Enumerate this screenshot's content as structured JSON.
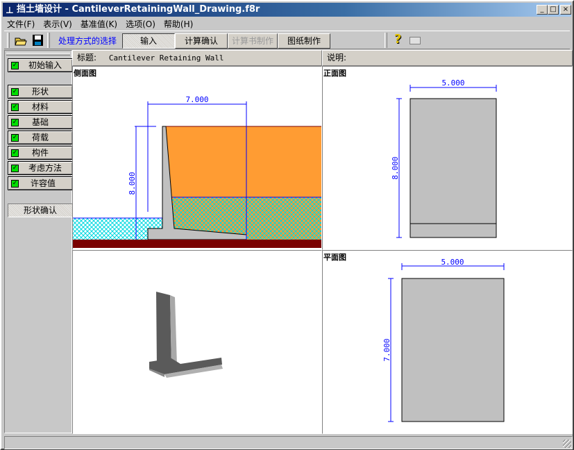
{
  "window": {
    "title": "挡土墙设计 - CantileverRetainingWall_Drawing.f8r",
    "minimize": "_",
    "maximize": "□",
    "close": "×"
  },
  "menu": [
    "文件(F)",
    "表示(V)",
    "基准值(K)",
    "选项(O)",
    "帮助(H)"
  ],
  "toolbar": {
    "mode_label": "处理方式的选择",
    "tabs": [
      "输入",
      "计算确认",
      "计算书制作",
      "图纸制作"
    ],
    "help_icon": "?"
  },
  "sidebar": {
    "initial": "初始输入",
    "items": [
      "形状",
      "材料",
      "基础",
      "荷载",
      "构件",
      "考虑方法",
      "许容值"
    ],
    "confirm": "形状确认",
    "check": "✓"
  },
  "header": {
    "title_label": "标题:",
    "title_value": "Cantilever Retaining Wall",
    "desc_label": "说明:"
  },
  "views": {
    "side": {
      "label": "侧面图",
      "width_dim": "7.000",
      "height_dim": "8.000"
    },
    "front": {
      "label": "正面图",
      "width_dim": "5.000",
      "height_dim": "8.000"
    },
    "plan": {
      "label": "平面图",
      "width_dim": "5.000",
      "height_dim": "7.000"
    }
  },
  "colors": {
    "backfill": "#ff9c33",
    "water": "#00e0e0",
    "ground": "#7a0000",
    "concrete": "#c0c0c0",
    "dimension": "#0000ff"
  }
}
